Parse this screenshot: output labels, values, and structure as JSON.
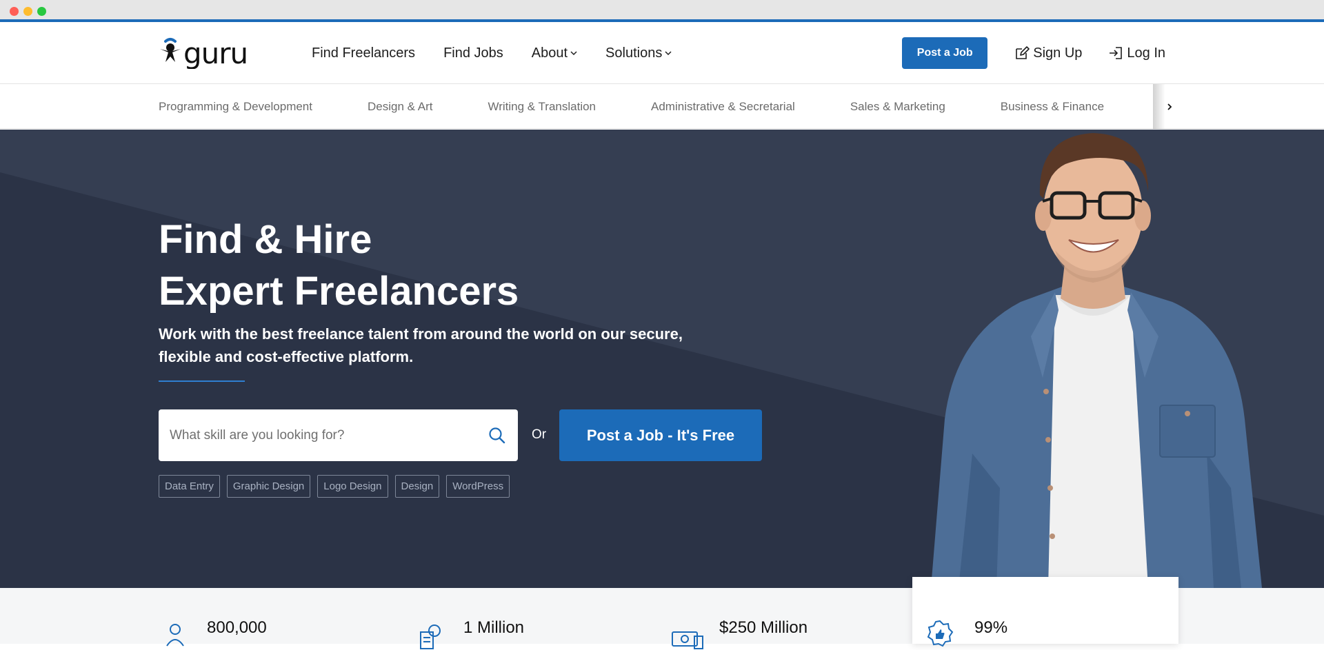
{
  "brand": {
    "name": "guru",
    "accent": "#1c6bb8",
    "hero_bg": "#2b3346"
  },
  "nav": {
    "items": [
      {
        "label": "Find Freelancers",
        "has_dropdown": false
      },
      {
        "label": "Find Jobs",
        "has_dropdown": false
      },
      {
        "label": "About",
        "has_dropdown": true
      },
      {
        "label": "Solutions",
        "has_dropdown": true
      }
    ],
    "post_job": "Post a Job",
    "sign_up": "Sign Up",
    "log_in": "Log In"
  },
  "categories": [
    "Programming & Development",
    "Design & Art",
    "Writing & Translation",
    "Administrative & Secretarial",
    "Sales & Marketing",
    "Business & Finance"
  ],
  "hero": {
    "title_line1": "Find & Hire",
    "title_line2": "Expert Freelancers",
    "subtitle": "Work with the best freelance talent from around the world on our secure, flexible and cost-effective platform.",
    "search_placeholder": "What skill are you looking for?",
    "or": "Or",
    "cta": "Post a Job - It's Free",
    "tags": [
      "Data Entry",
      "Graphic Design",
      "Logo Design",
      "Design",
      "WordPress"
    ]
  },
  "stats": [
    {
      "value": "800,000",
      "icon": "freelancer-icon"
    },
    {
      "value": "1 Million",
      "icon": "invoice-icon"
    },
    {
      "value": "$250 Million",
      "icon": "money-icon"
    },
    {
      "value": "99%",
      "icon": "thumbs-up-badge-icon"
    }
  ]
}
